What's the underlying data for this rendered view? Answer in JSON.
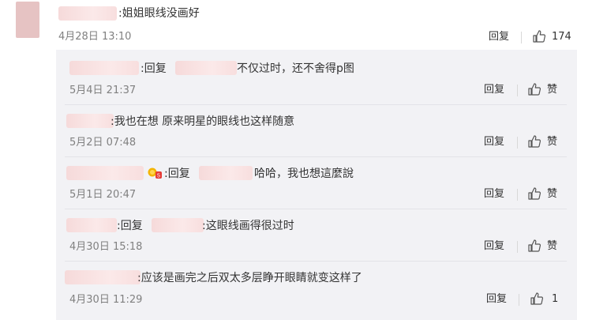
{
  "top_comment": {
    "text": ":姐姐眼线没画好",
    "date": "4月28日 13:10",
    "reply_label": "回复",
    "like_count": "174"
  },
  "replies": [
    {
      "prefix": ":回复",
      "text": "不仅过时，还不舍得p图",
      "date": "5月4日 21:37",
      "reply_label": "回复",
      "like_label": "赞"
    },
    {
      "prefix": "",
      "text": ":我也在想 原来明星的眼线也这样随意",
      "date": "5月2日 07:48",
      "reply_label": "回复",
      "like_label": "赞"
    },
    {
      "prefix": ":回复",
      "text": "哈哈，我也想這麼說",
      "date": "5月1日 20:47",
      "reply_label": "回复",
      "like_label": "赞"
    },
    {
      "prefix": ":回复",
      "text": ":这眼线画得很过时",
      "date": "4月30日 15:18",
      "reply_label": "回复",
      "like_label": "赞"
    },
    {
      "prefix": "",
      "text": ":应该是画完之后双太多层睁开眼睛就变这样了",
      "date": "4月30日 11:29",
      "reply_label": "回复",
      "like_count": "1"
    }
  ],
  "icons": {
    "like": "thumbs-up-icon",
    "medal": "medal-badge-icon"
  },
  "colors": {
    "panel_bg": "#f2f2f5",
    "meta_text": "#808080",
    "blur": "#f8e0e0"
  }
}
